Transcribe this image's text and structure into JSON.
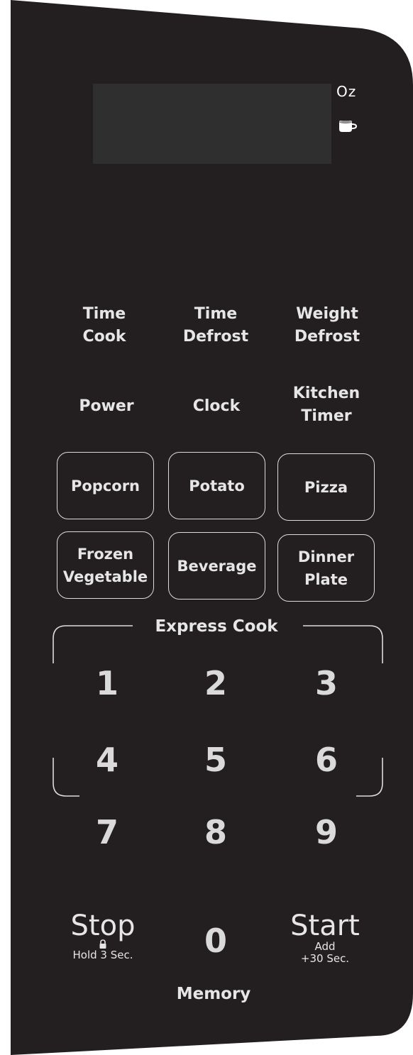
{
  "display": {
    "oz_indicator": "Oz",
    "beverage_indicator_icon": "cup-icon"
  },
  "function_keys": {
    "time_cook": [
      "Time",
      "Cook"
    ],
    "time_defrost": [
      "Time",
      "Defrost"
    ],
    "weight_defrost": [
      "Weight",
      "Defrost"
    ],
    "power": "Power",
    "clock": "Clock",
    "kitchen_timer": [
      "Kitchen",
      "Timer"
    ]
  },
  "auto_keys": {
    "popcorn": "Popcorn",
    "potato": "Potato",
    "pizza": "Pizza",
    "frozen_vegetable": [
      "Frozen",
      "Vegetable"
    ],
    "beverage": "Beverage",
    "dinner_plate": [
      "Dinner",
      "Plate"
    ]
  },
  "express_cook_label": "Express Cook",
  "number_keys": [
    "1",
    "2",
    "3",
    "4",
    "5",
    "6",
    "7",
    "8",
    "9",
    "0"
  ],
  "stop": {
    "label": "Stop",
    "sub": "Hold 3 Sec.",
    "icon": "lock-icon"
  },
  "start": {
    "label": "Start",
    "sub1": "Add",
    "sub2": "+30 Sec."
  },
  "memory_label": "Memory",
  "colors": {
    "panel": "#231f20",
    "display": "#2f2f2f",
    "text": "#e6e6e6",
    "outline": "#dcdcdc"
  }
}
